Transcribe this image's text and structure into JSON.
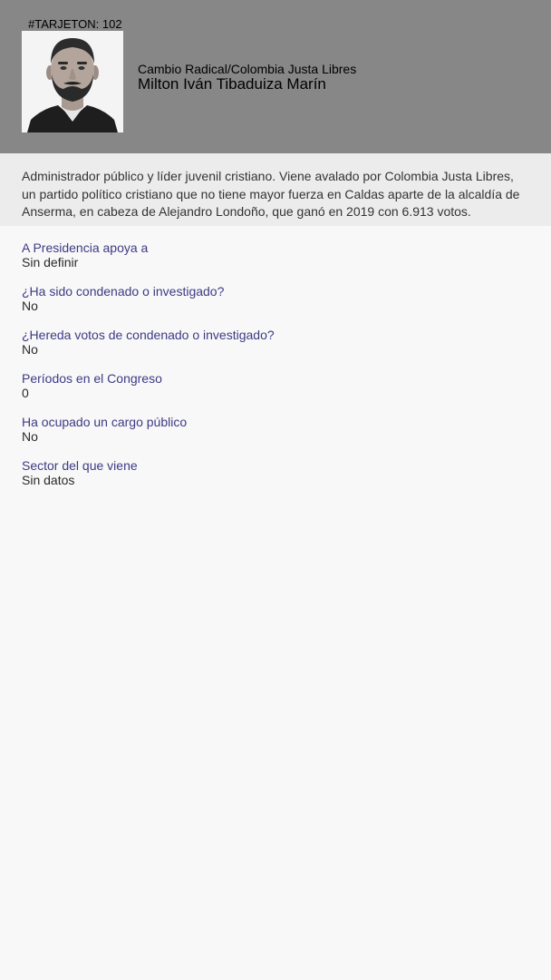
{
  "header": {
    "tarjeton": "#TARJETON: 102",
    "party": "Cambio Radical/Colombia Justa Libres",
    "name": "Milton Iván Tibaduiza Marín",
    "photo_icon": "candidate-portrait"
  },
  "bio": "Administrador público y líder juvenil cristiano. Viene avalado por Colombia Justa Libres, un partido político cristiano que no tiene mayor fuerza en Caldas aparte de la alcaldía de Anserma, en cabeza de Alejandro Londoño, que ganó en 2019 con 6.913 votos.",
  "facts": [
    {
      "q": "A Presidencia apoya a",
      "a": "Sin definir"
    },
    {
      "q": "¿Ha sido condenado o investigado?",
      "a": "No"
    },
    {
      "q": "¿Hereda votos de condenado o investigado?",
      "a": "No"
    },
    {
      "q": "Períodos en el Congreso",
      "a": "0"
    },
    {
      "q": "Ha ocupado un cargo público",
      "a": "No"
    },
    {
      "q": "Sector del que viene",
      "a": "Sin datos"
    }
  ],
  "colors": {
    "header_bg": "#878787",
    "bio_bg": "#ececec",
    "page_bg": "#f8f8f8",
    "question_text": "#3d3a84"
  }
}
